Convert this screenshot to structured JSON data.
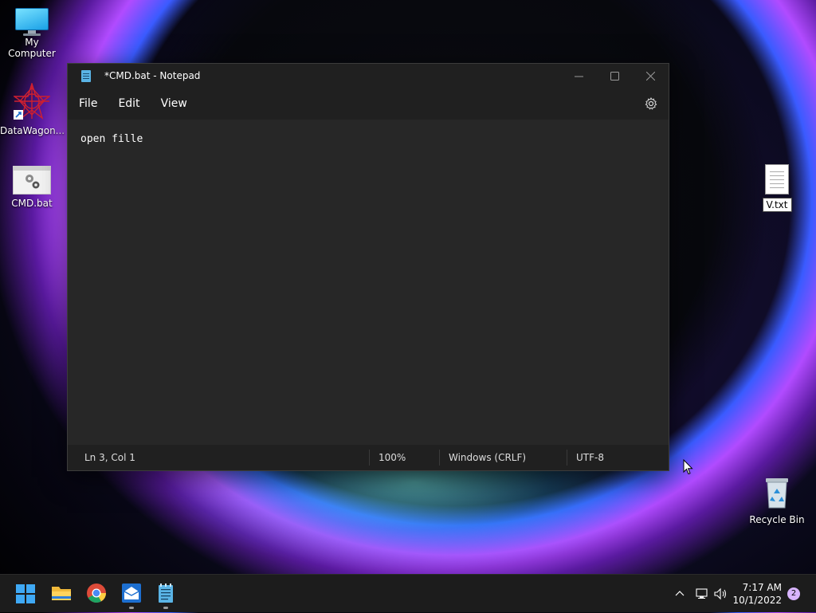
{
  "desktop": {
    "icons": [
      {
        "label": "My Computer"
      },
      {
        "label": "DataWagon..."
      },
      {
        "label": "CMD.bat"
      },
      {
        "label": "V.txt"
      },
      {
        "label": "Recycle Bin"
      }
    ]
  },
  "notepad": {
    "title": "*CMD.bat - Notepad",
    "menu": [
      "File",
      "Edit",
      "View"
    ],
    "content": "open fille",
    "status": {
      "position": "Ln 3, Col 1",
      "zoom": "100%",
      "line_ending": "Windows (CRLF)",
      "encoding": "UTF-8"
    }
  },
  "taskbar": {
    "apps": [
      "start-icon",
      "file-explorer-icon",
      "chrome-icon",
      "mail-app-icon",
      "notepad-icon"
    ],
    "clock": {
      "time": "7:17 AM",
      "date": "10/1/2022"
    },
    "notification_count": "2"
  },
  "colors": {
    "accent": "#5ab4e6",
    "window_bg": "#272727",
    "titlebar_bg": "#202020"
  }
}
